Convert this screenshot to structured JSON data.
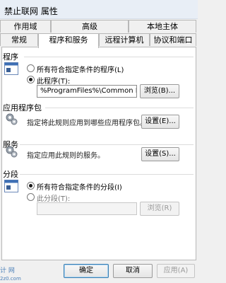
{
  "window": {
    "title": "禁止联网 属性"
  },
  "tabs_row1": [
    "作用域",
    "高级",
    "本地主体"
  ],
  "tabs_row2": [
    "常规",
    "程序和服务",
    "远程计算机",
    "协议和端口"
  ],
  "program": {
    "label": "程序",
    "option_all": "所有符合指定条件的程序(L)",
    "option_this": "此程序(T):",
    "path": "%ProgramFiles%\\Common Files\\S",
    "browse_label": "浏览(B)..."
  },
  "app_package": {
    "label": "应用程序包",
    "description": "指定将此规则应用到哪些应用程序包。",
    "settings_label": "设置(E)..."
  },
  "services": {
    "label": "服务",
    "description": "指定应用此规则的服务。",
    "settings_label": "设置(S)..."
  },
  "fragment": {
    "label": "分段",
    "option_all": "所有符合指定条件的分段(I)",
    "option_this": "此分段(T):",
    "path": "",
    "browse_label": "浏览(R)"
  },
  "footer": {
    "ok_label": "确定",
    "cancel_label": "取消",
    "apply_label": "应用(A)"
  },
  "watermark": {
    "text": "计 网",
    "url": "2z0.com"
  }
}
